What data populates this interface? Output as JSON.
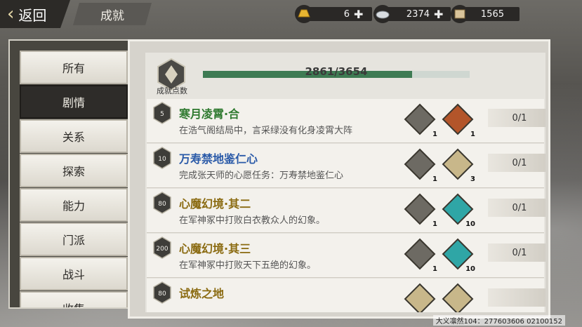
{
  "header": {
    "back_label": "返回",
    "title": "成就",
    "currencies": [
      {
        "icon": "gold-ingot-icon",
        "value": "6",
        "color": "#e7b531"
      },
      {
        "icon": "silver-ingot-icon",
        "value": "2374",
        "color": "#d9dde1"
      },
      {
        "icon": "scroll-icon",
        "value": "1565",
        "color": "#d9c49a"
      }
    ]
  },
  "tabs": [
    {
      "label": "所有",
      "active": false
    },
    {
      "label": "剧情",
      "active": true
    },
    {
      "label": "关系",
      "active": false
    },
    {
      "label": "探索",
      "active": false
    },
    {
      "label": "能力",
      "active": false
    },
    {
      "label": "门派",
      "active": false
    },
    {
      "label": "战斗",
      "active": false
    },
    {
      "label": "收集",
      "active": false
    }
  ],
  "progress": {
    "label": "成就点数",
    "text": "2861/3654",
    "current": 2861,
    "total": 3654
  },
  "achievements": [
    {
      "points": "5",
      "title": "寒月凌霄·合",
      "desc": "在浩气阁结局中，言采绿没有化身凌霄大阵",
      "title_color": "#2f7a2f",
      "rewards": [
        {
          "icon": "character-portrait-icon",
          "count": "1"
        },
        {
          "icon": "fire-book-icon",
          "count": "1"
        }
      ],
      "count": "0/1"
    },
    {
      "points": "10",
      "title": "万寿禁地鉴仁心",
      "desc": "完成张天师的心愿任务：万寿禁地鉴仁心",
      "title_color": "#2a5aa8",
      "rewards": [
        {
          "icon": "elder-portrait-icon",
          "count": "1"
        },
        {
          "icon": "treasure-map-icon",
          "count": "3"
        }
      ],
      "count": "0/1"
    },
    {
      "points": "80",
      "title": "心魔幻境·其二",
      "desc": "在军神冢中打败白衣教众人的幻象。",
      "title_color": "#8a6a10",
      "rewards": [
        {
          "icon": "character-portrait-icon",
          "count": "1"
        },
        {
          "icon": "spirit-orb-icon",
          "count": "10"
        }
      ],
      "count": "0/1"
    },
    {
      "points": "200",
      "title": "心魔幻境·其三",
      "desc": "在军神冢中打败天下五绝的幻象。",
      "title_color": "#8a6a10",
      "rewards": [
        {
          "icon": "character-portrait-icon",
          "count": "1"
        },
        {
          "icon": "spirit-orb-icon",
          "count": "10"
        }
      ],
      "count": "0/1"
    },
    {
      "points": "80",
      "title": "试炼之地",
      "desc": "",
      "title_color": "#8a6a10",
      "rewards": [
        {
          "icon": "scroll-reward-icon",
          "count": ""
        },
        {
          "icon": "treasure-map-icon",
          "count": ""
        }
      ],
      "count": ""
    }
  ],
  "footer": {
    "id_text": "大义凛然104：277603606 02100152"
  }
}
